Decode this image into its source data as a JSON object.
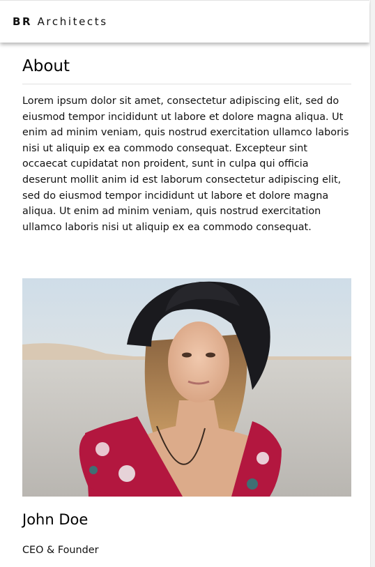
{
  "navbar": {
    "brand_strong": "BR",
    "brand_rest": "Architects"
  },
  "about": {
    "title": "About",
    "body": "Lorem ipsum dolor sit amet, consectetur adipiscing elit, sed do eiusmod tempor incididunt ut labore et dolore magna aliqua. Ut enim ad minim veniam, quis nostrud exercitation ullamco laboris nisi ut aliquip ex ea commodo consequat. Excepteur sint occaecat cupidatat non proident, sunt in culpa qui officia deserunt mollit anim id est laborum consectetur adipiscing elit, sed do eiusmod tempor incididunt ut labore et dolore magna aliqua. Ut enim ad minim veniam, quis nostrud exercitation ullamco laboris nisi ut aliquip ex ea commodo consequat."
  },
  "team_member": {
    "name": "John Doe",
    "role": "CEO & Founder"
  },
  "colors": {
    "sky": "#dde7ee",
    "ground": "#c9c7c3",
    "hat": "#1a1a1e",
    "dress": "#b3173f"
  }
}
